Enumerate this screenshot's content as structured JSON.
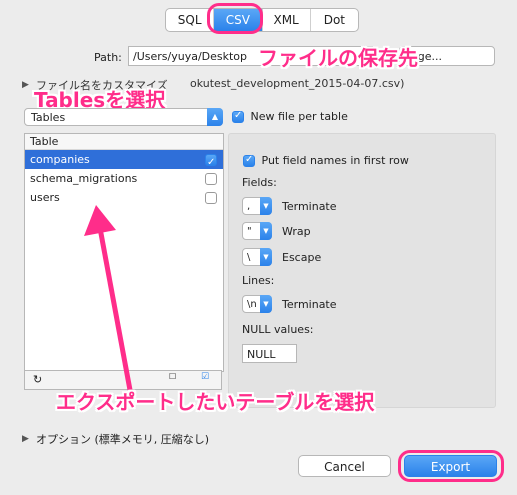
{
  "tabs": [
    {
      "label": "SQL"
    },
    {
      "label": "CSV"
    },
    {
      "label": "XML"
    },
    {
      "label": "Dot"
    }
  ],
  "selected_tab": "CSV",
  "path": {
    "label": "Path:",
    "value": "/Users/yuya/Desktop",
    "button": "ange..."
  },
  "annotations": {
    "save_destination": "ファイルの保存先",
    "select_tables": "Tablesを選択",
    "select_tables_export": "エクスポートしたいテーブルを選択"
  },
  "custom_disclosure": {
    "left": "ファイル名をカスタマイズ",
    "right": "okutest_development_2015-04-07.csv)"
  },
  "tables_dropdown": {
    "label": "Tables"
  },
  "new_file_per_table": {
    "label": "New file per table",
    "checked": true
  },
  "table_list": {
    "header": "Table",
    "rows": [
      {
        "label": "companies",
        "checked": true,
        "selected": true
      },
      {
        "label": "schema_migrations",
        "checked": false,
        "selected": false
      },
      {
        "label": "users",
        "checked": false,
        "selected": false
      }
    ]
  },
  "settings": {
    "put_field_names": "Put field names in first row",
    "fields_label": "Fields:",
    "terminate_value": ",",
    "terminate_label": "Terminate",
    "wrap_value": "\"",
    "wrap_label": "Wrap",
    "escape_value": "\\",
    "escape_label": "Escape",
    "lines_label": "Lines:",
    "lines_value": "\\n",
    "lines_terminate_label": "Terminate",
    "null_label": "NULL values:",
    "null_value": "NULL"
  },
  "options_row": "オプション (標準メモリ, 圧縮なし)",
  "buttons": {
    "cancel": "Cancel",
    "export": "Export"
  },
  "colors": {
    "accent": "#2b82ea",
    "annotation": "#ff2d8a",
    "selected_row": "#2f6fd9"
  }
}
